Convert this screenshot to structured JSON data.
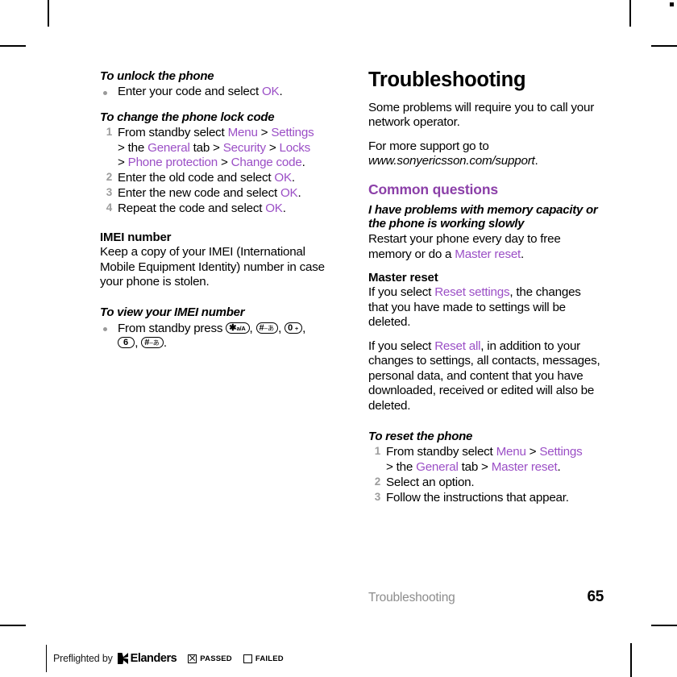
{
  "document": {
    "section_footer": "Troubleshooting",
    "page_number": "65"
  },
  "colors": {
    "link_purple": "#9B4FC6",
    "heading_purple": "#8B3FA8",
    "list_number_gray": "#9c9c9c",
    "footer_gray": "#8d8d8d"
  },
  "left_column": {
    "unlock": {
      "heading": "To unlock the phone",
      "bullet": {
        "pre": "Enter your code and select ",
        "link": "OK",
        "post": "."
      }
    },
    "change_lock_code": {
      "heading": "To change the phone lock code",
      "steps": [
        {
          "num": "1",
          "line1_pre": "From standby select ",
          "line1_link1": "Menu",
          "line1_mid1": " > ",
          "line1_link2": "Settings",
          "line2_pre": "> the ",
          "line2_link1": "General",
          "line2_mid1": " tab > ",
          "line2_link2": "Security",
          "line2_mid2": " > ",
          "line2_link3": "Locks",
          "line3_pre": "> ",
          "line3_link1": "Phone protection",
          "line3_mid1": " > ",
          "line3_link2": "Change code",
          "line3_post": "."
        },
        {
          "num": "2",
          "pre": "Enter the old code and select ",
          "link": "OK",
          "post": "."
        },
        {
          "num": "3",
          "pre": "Enter the new code and select ",
          "link": "OK",
          "post": "."
        },
        {
          "num": "4",
          "pre": "Repeat the code and select ",
          "link": "OK",
          "post": "."
        }
      ]
    },
    "imei": {
      "heading": "IMEI number",
      "body": "Keep a copy of your IMEI (International Mobile Equipment Identity) number in case your phone is stolen."
    },
    "view_imei": {
      "heading": "To view your IMEI number",
      "bullet_pre": "From standby press ",
      "keys": [
        {
          "name": "star-key",
          "main": "✱",
          "sub": "a/A"
        },
        {
          "name": "hash-key",
          "main": "#",
          "sub": "–あ"
        },
        {
          "name": "zero-key",
          "main": "0",
          "sub": "+"
        },
        {
          "name": "six-key",
          "main": "6",
          "sub": ""
        },
        {
          "name": "hash-key-2",
          "main": "#",
          "sub": "–あ"
        }
      ],
      "separator": ", ",
      "terminator": "."
    }
  },
  "right_column": {
    "title": "Troubleshooting",
    "intro1": "Some problems will require you to call your network operator.",
    "intro2_pre": "For more support go to ",
    "intro2_url": "www.sonyericsson.com/support",
    "intro2_post": ".",
    "common_questions_heading": "Common questions",
    "memory": {
      "heading": "I have problems with memory capacity or the phone is working slowly",
      "body_pre": "Restart your phone every day to free memory or do a ",
      "body_link": "Master reset",
      "body_post": "."
    },
    "master_reset": {
      "heading": "Master reset",
      "para1_pre": "If you select ",
      "para1_link": "Reset settings",
      "para1_post": ", the changes that you have made to settings will be deleted.",
      "para2_pre": "If you select ",
      "para2_link": "Reset all",
      "para2_post": ", in addition to your changes to settings, all contacts, messages, personal data, and content that you have downloaded, received or edited will also be deleted."
    },
    "reset_phone": {
      "heading": "To reset the phone",
      "steps": [
        {
          "num": "1",
          "line1_pre": "From standby select ",
          "line1_link1": "Menu",
          "line1_mid1": " > ",
          "line1_link2": "Settings",
          "line2_pre": "> the ",
          "line2_link1": "General",
          "line2_mid1": " tab > ",
          "line2_link2": "Master reset",
          "line2_post": "."
        },
        {
          "num": "2",
          "text": "Select an option."
        },
        {
          "num": "3",
          "text": "Follow the instructions that appear."
        }
      ]
    }
  },
  "preflight": {
    "label": "Preflighted by",
    "brand": "Elanders",
    "passed_label": "PASSED",
    "failed_label": "FAILED"
  }
}
